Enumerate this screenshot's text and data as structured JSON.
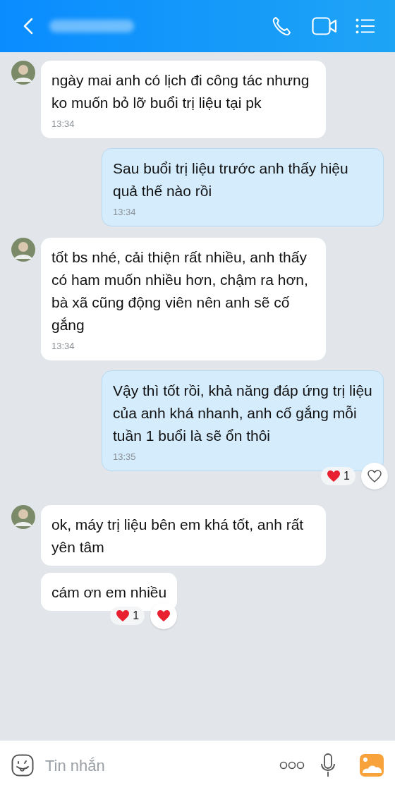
{
  "messages": [
    {
      "kind": "incoming",
      "avatar": true,
      "text": "ngày mai anh có lịch đi công tác nhưng ko muốn bỏ lỡ buổi trị liệu tại pk",
      "time": "13:34"
    },
    {
      "kind": "outgoing",
      "text": "Sau buổi trị liệu trước anh thấy hiệu quả thế nào rồi",
      "time": "13:34"
    },
    {
      "kind": "incoming",
      "avatar": true,
      "text": "tốt bs nhé, cải thiện rất nhiều, anh thấy có ham muốn nhiều hơn, chậm ra hơn, bà xã cũng động viên nên anh sẽ cố gắng",
      "time": "13:34"
    },
    {
      "kind": "outgoing",
      "text": "Vậy thì tốt rồi, khả năng đáp ứng trị liệu của anh khá nhanh, anh cố gắng mỗi tuần 1 buổi là sẽ ổn thôi",
      "time": "13:35",
      "reaction_count": "1",
      "reacted": false
    },
    {
      "kind": "incoming",
      "avatar": true,
      "text": "ok, máy trị liệu bên em khá tốt, anh rất yên tâm"
    },
    {
      "kind": "incoming",
      "avatar": false,
      "text": "cám ơn em nhiều",
      "reaction_count": "1",
      "reacted": true
    }
  ],
  "composer": {
    "placeholder": "Tin nhắn"
  }
}
